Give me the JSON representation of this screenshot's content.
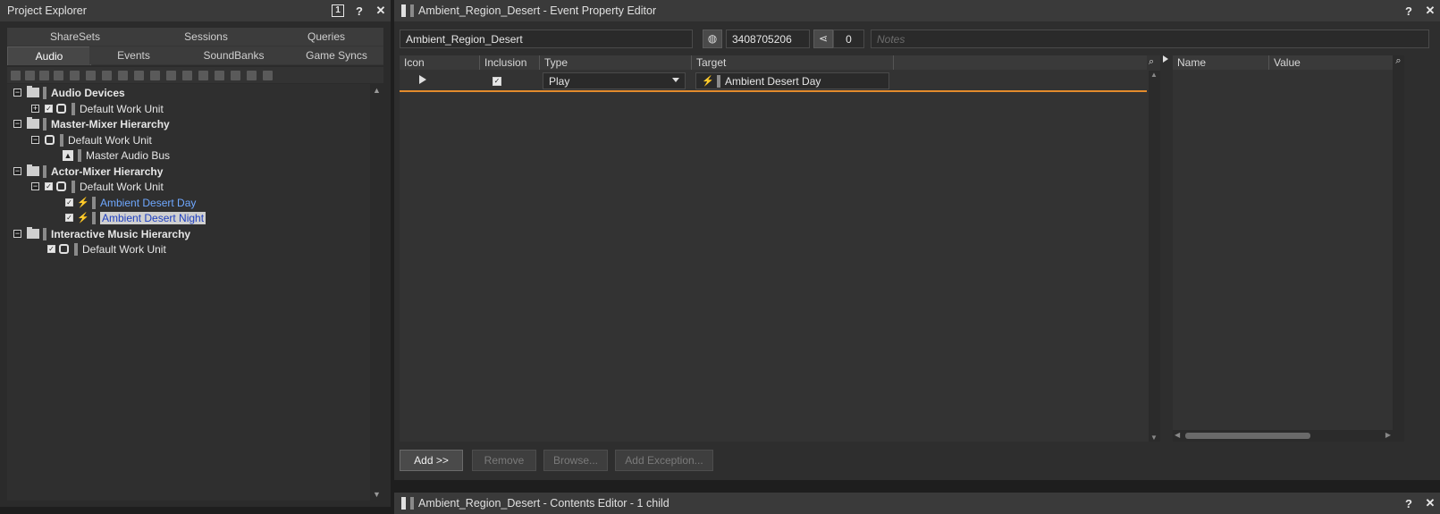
{
  "project_explorer": {
    "title": "Project Explorer",
    "title_buttons": [
      "1",
      "?",
      "✕"
    ],
    "tabs_row1": [
      "ShareSets",
      "Sessions",
      "Queries"
    ],
    "tabs_row2": [
      "Audio",
      "Events",
      "SoundBanks",
      "Game Syncs"
    ],
    "active_tab": "Audio",
    "tree": {
      "audio_devices": "Audio Devices",
      "audio_devices_wu": "Default Work Unit",
      "master_mixer": "Master-Mixer Hierarchy",
      "master_mixer_wu": "Default Work Unit",
      "master_audio_bus": "Master Audio Bus",
      "actor_mixer": "Actor-Mixer Hierarchy",
      "actor_mixer_wu": "Default Work Unit",
      "ambient_day": "Ambient Desert Day",
      "ambient_night": "Ambient Desert Night",
      "interactive_music": "Interactive Music Hierarchy",
      "interactive_music_wu": "Default Work Unit"
    }
  },
  "event_editor": {
    "title": "Ambient_Region_Desert - Event Property Editor",
    "name_value": "Ambient_Region_Desert",
    "id_value": "3408705206",
    "share_count": "0",
    "notes_placeholder": "Notes",
    "columns": [
      "Icon",
      "Inclusion",
      "Type",
      "Target"
    ],
    "action_row": {
      "type": "Play",
      "target": "Ambient Desert Day"
    },
    "prop_columns": [
      "Name",
      "Value"
    ],
    "buttons": {
      "add": "Add >>",
      "remove": "Remove",
      "browse": "Browse...",
      "add_exception": "Add Exception..."
    }
  },
  "contents_editor": {
    "title": "Ambient_Region_Desert - Contents Editor - 1 child"
  },
  "colors": {
    "accent_orange": "#e38b2c",
    "link_blue": "#6fa8ff",
    "selection_text": "#1e3fbf"
  }
}
